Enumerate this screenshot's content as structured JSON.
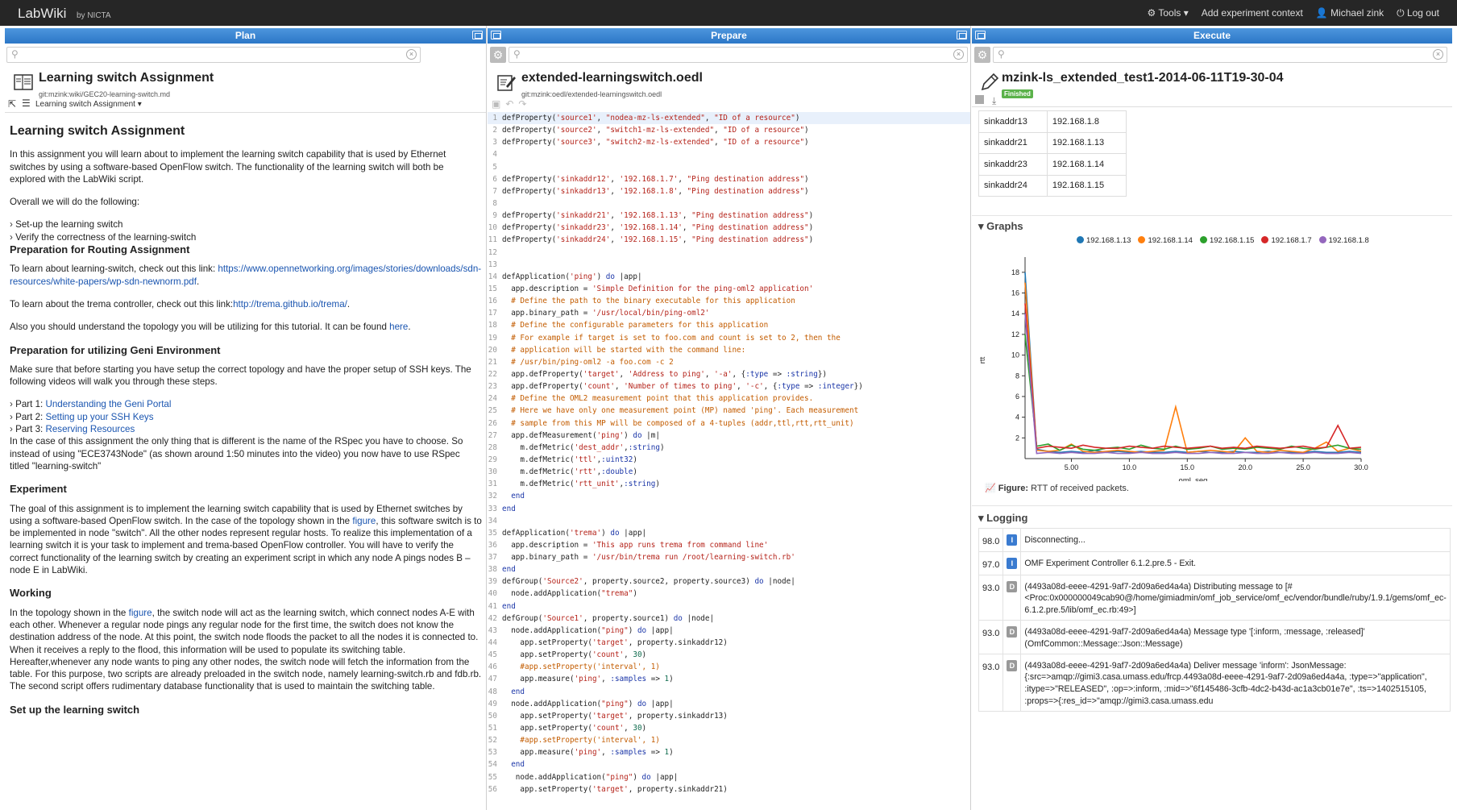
{
  "topbar": {
    "brand": "LabWiki",
    "byline": "by NICTA",
    "tools": "⚙ Tools ▾",
    "add_context": "Add experiment context",
    "user": "👤 Michael zink",
    "logout": "⏻ Log out"
  },
  "plan": {
    "header": "Plan",
    "doc_title": "Learning switch Assignment",
    "doc_path": "git:mzink:wiki/GEC20-learning-switch.md",
    "toolbar_label": "Learning switch Assignment",
    "h1": "Learning switch Assignment",
    "intro": "In this assignment you will learn about to implement the learning switch capability that is used by Ethernet switches by using a software-based OpenFlow switch. The functionality of the learning switch will both be explored with the LabWiki script.",
    "overall": "Overall we will do the following:",
    "bullets": [
      "Set-up the learning switch",
      "Verify the correctness of the learning-switch"
    ],
    "h_routing": "Preparation for Routing Assignment",
    "routing_text": "To learn about learning-switch, check out this link: ",
    "routing_link": "https://www.opennetworking.org/images/stories/downloads/sdn-resources/white-papers/wp-sdn-newnorm.pdf",
    "routing_end": ".",
    "trema_text": "To learn about the trema controller, check out this link:",
    "trema_link": "http://trema.github.io/trema/",
    "trema_end": ".",
    "topology_text": "Also you should understand the topology you will be utilizing for this tutorial. It can be found ",
    "topology_link": "here",
    "topology_end": ".",
    "h_geni": "Preparation for utilizing Geni Environment",
    "geni_text": "Make sure that before starting you have setup the correct topology and have the proper setup of SSH keys. The following videos will walk you through these steps.",
    "parts": [
      {
        "label": "Part 1: ",
        "link": "Understanding the Geni Portal"
      },
      {
        "label": "Part 2: ",
        "link": "Setting up your SSH Keys"
      },
      {
        "label": "Part 3: ",
        "link": "Reserving Resources"
      }
    ],
    "rspec_text": "In the case of this assignment the only thing that is different is the name of the RSpec you have to choose. So instead of using \"ECE3743Node\" (as shown around 1:50 minutes into the video) you now have to use RSpec titled \"learning-switch\"",
    "h_experiment": "Experiment",
    "exp_text1": "The goal of this assignment is to implement the learning switch capability that is used by Ethernet switches by using a software-based OpenFlow switch. In the case of the topology shown in the ",
    "exp_link": "figure",
    "exp_text2": ", this software switch is to be implemented in node \"switch\". All the other nodes represent regular hosts. To realize this implementation of a learning switch it is your task to implement and trema-based OpenFlow controller. You will have to verify the correct functionality of the learning switch by creating an experiment script in which any node A pings nodes B – node E in LabWiki.",
    "h_working": "Working",
    "work_text1": "In the topology shown in the ",
    "work_link": "figure",
    "work_text2": ", the switch node will act as the learning switch, which connect nodes A-E with each other. Whenever a regular node pings any regular node for the first time, the switch does not know the destination address of the node. At this point, the switch node floods the packet to all the nodes it is connected to. When it receives a reply to the flood, this information will be used to populate its switching table. Hereafter,whenever any node wants to ping any other nodes, the switch node will fetch the information from the table. For this purpose, two scripts are already preloaded in the switch node, namely learning-switch.rb and fdb.rb. The second script offers rudimentary database functionality that is used to maintain the switching table.",
    "h_setup": "Set up the learning switch"
  },
  "prepare": {
    "header": "Prepare",
    "doc_title": "extended-learningswitch.oedl",
    "doc_path": "git:mzink:oedl/extended-learningswitch.oedl",
    "code": [
      "defProperty('source1', \"nodea-mz-ls-extended\", \"ID of a resource\")",
      "defProperty('source2', \"switch1-mz-ls-extended\", \"ID of a resource\")",
      "defProperty('source3', \"switch2-mz-ls-extended\", \"ID of a resource\")",
      "",
      "",
      "defProperty('sinkaddr12', '192.168.1.7', \"Ping destination address\")",
      "defProperty('sinkaddr13', '192.168.1.8', \"Ping destination address\")",
      "",
      "defProperty('sinkaddr21', '192.168.1.13', \"Ping destination address\")",
      "defProperty('sinkaddr23', '192.168.1.14', \"Ping destination address\")",
      "defProperty('sinkaddr24', '192.168.1.15', \"Ping destination address\")",
      "",
      "",
      "defApplication('ping') do |app|",
      "  app.description = 'Simple Definition for the ping-oml2 application'",
      "  # Define the path to the binary executable for this application",
      "  app.binary_path = '/usr/local/bin/ping-oml2'",
      "  # Define the configurable parameters for this application",
      "  # For example if target is set to foo.com and count is set to 2, then the",
      "  # application will be started with the command line:",
      "  # /usr/bin/ping-oml2 -a foo.com -c 2",
      "  app.defProperty('target', 'Address to ping', '-a', {:type => :string})",
      "  app.defProperty('count', 'Number of times to ping', '-c', {:type => :integer})",
      "  # Define the OML2 measurement point that this application provides.",
      "  # Here we have only one measurement point (MP) named 'ping'. Each measurement",
      "  # sample from this MP will be composed of a 4-tuples (addr,ttl,rtt,rtt_unit)",
      "  app.defMeasurement('ping') do |m|",
      "    m.defMetric('dest_addr',:string)",
      "    m.defMetric('ttl',:uint32)",
      "    m.defMetric('rtt',:double)",
      "    m.defMetric('rtt_unit',:string)",
      "  end",
      "end",
      "",
      "defApplication('trema') do |app|",
      "  app.description = 'This app runs trema from command line'",
      "  app.binary_path = '/usr/bin/trema run /root/learning-switch.rb'",
      "end",
      "defGroup('Source2', property.source2, property.source3) do |node|",
      "  node.addApplication(\"trema\")",
      "end",
      "defGroup('Source1', property.source1) do |node|",
      "  node.addApplication(\"ping\") do |app|",
      "    app.setProperty('target', property.sinkaddr12)",
      "    app.setProperty('count', 30)",
      "    #app.setProperty('interval', 1)",
      "    app.measure('ping', :samples => 1)",
      "  end",
      "  node.addApplication(\"ping\") do |app|",
      "    app.setProperty('target', property.sinkaddr13)",
      "    app.setProperty('count', 30)",
      "    #app.setProperty('interval', 1)",
      "    app.measure('ping', :samples => 1)",
      "  end",
      "   node.addApplication(\"ping\") do |app|",
      "    app.setProperty('target', property.sinkaddr21)"
    ]
  },
  "execute": {
    "header": "Execute",
    "doc_title": "mzink-ls_extended_test1-2014-06-11T19-30-04",
    "status": "Finished",
    "props": [
      {
        "name": "sinkaddr13",
        "value": "192.168.1.8"
      },
      {
        "name": "sinkaddr21",
        "value": "192.168.1.13"
      },
      {
        "name": "sinkaddr23",
        "value": "192.168.1.14"
      },
      {
        "name": "sinkaddr24",
        "value": "192.168.1.15"
      }
    ],
    "graphs_title": "▾ Graphs",
    "figure_label": "Figure:",
    "figure_caption": " RTT of received packets.",
    "logging_title": "▾ Logging",
    "logs": [
      {
        "time": "98.0",
        "level": "i",
        "icon": "I",
        "msg": "Disconnecting..."
      },
      {
        "time": "97.0",
        "level": "i",
        "icon": "I",
        "msg": "OMF Experiment Controller 6.1.2.pre.5 - Exit."
      },
      {
        "time": "93.0",
        "level": "d",
        "icon": "D",
        "msg": "(4493a08d-eeee-4291-9af7-2d09a6ed4a4a) Distributing message to [#<Proc:0x000000049cab90@/home/gimiadmin/omf_job_service/omf_ec/vendor/bundle/ruby/1.9.1/gems/omf_ec-6.1.2.pre.5/lib/omf_ec.rb:49>]"
      },
      {
        "time": "93.0",
        "level": "d",
        "icon": "D",
        "msg": "(4493a08d-eeee-4291-9af7-2d09a6ed4a4a) Message type '[:inform, :message, :released]' (OmfCommon::Message::Json::Message)"
      },
      {
        "time": "93.0",
        "level": "d",
        "icon": "D",
        "msg": "(4493a08d-eeee-4291-9af7-2d09a6ed4a4a) Deliver message 'inform': JsonMessage: {:src=>amqp://gimi3.casa.umass.edu/frcp.4493a08d-eeee-4291-9af7-2d09a6ed4a4a, :type=>\"application\", :itype=>\"RELEASED\", :op=>:inform, :mid=>\"6f145486-3cfb-4dc2-b43d-ac1a3cb01e7e\", :ts=>1402515105, :props=>{:res_id=>\"amqp://gimi3.casa.umass.edu"
      }
    ]
  },
  "chart_data": {
    "type": "line",
    "xlabel": "oml_seq",
    "ylabel": "rtt",
    "xlim": [
      1,
      30
    ],
    "ylim": [
      0,
      19
    ],
    "x_ticks": [
      "5.00",
      "10.0",
      "15.0",
      "20.0",
      "25.0",
      "30.0"
    ],
    "y_ticks": [
      "2",
      "4",
      "6",
      "8",
      "10",
      "12",
      "14",
      "16",
      "18"
    ],
    "legend_position": "top",
    "x": [
      1,
      2,
      3,
      4,
      5,
      6,
      7,
      8,
      9,
      10,
      11,
      12,
      13,
      14,
      15,
      16,
      17,
      18,
      19,
      20,
      21,
      22,
      23,
      24,
      25,
      26,
      27,
      28,
      29,
      30
    ],
    "series": [
      {
        "name": "192.168.1.13",
        "color": "#1f77b4",
        "values": [
          18,
          0.9,
          0.7,
          0.6,
          0.7,
          0.6,
          0.8,
          0.6,
          0.7,
          0.6,
          0.7,
          0.6,
          0.6,
          0.7,
          0.6,
          0.7,
          0.6,
          0.6,
          0.7,
          0.6,
          0.6,
          0.7,
          0.6,
          0.6,
          0.6,
          0.7,
          0.6,
          0.6,
          0.7,
          0.6
        ]
      },
      {
        "name": "192.168.1.14",
        "color": "#ff7f0e",
        "values": [
          17,
          0.8,
          0.7,
          0.8,
          1.4,
          0.7,
          0.6,
          0.7,
          0.8,
          0.7,
          0.6,
          0.7,
          0.8,
          5.0,
          0.6,
          0.7,
          0.8,
          0.7,
          0.6,
          2.0,
          0.7,
          0.6,
          0.8,
          0.7,
          0.6,
          1.0,
          1.6,
          0.7,
          1.0,
          0.7
        ]
      },
      {
        "name": "192.168.1.15",
        "color": "#2ca02c",
        "values": [
          12,
          1.2,
          1.4,
          0.8,
          1.3,
          0.9,
          0.8,
          1.0,
          1.1,
          0.9,
          1.3,
          1.0,
          0.9,
          1.2,
          0.9,
          1.0,
          1.2,
          0.9,
          1.0,
          0.9,
          1.1,
          1.0,
          0.9,
          1.2,
          1.0,
          0.9,
          1.1,
          1.3,
          1.0,
          0.9
        ]
      },
      {
        "name": "192.168.1.7",
        "color": "#d62728",
        "values": [
          15,
          1.0,
          1.2,
          1.1,
          1.0,
          1.3,
          1.1,
          1.0,
          1.0,
          1.2,
          1.1,
          1.0,
          1.2,
          1.1,
          1.0,
          1.1,
          1.2,
          1.0,
          1.1,
          1.0,
          1.2,
          1.1,
          1.0,
          1.1,
          1.2,
          1.0,
          1.1,
          3.2,
          1.0,
          1.1
        ]
      },
      {
        "name": "192.168.1.8",
        "color": "#9467bd",
        "values": [
          14,
          0.5,
          0.6,
          0.5,
          0.6,
          0.5,
          0.5,
          0.6,
          0.5,
          0.5,
          0.6,
          0.5,
          0.5,
          0.6,
          0.5,
          0.5,
          0.6,
          0.5,
          0.5,
          0.6,
          0.5,
          0.5,
          0.6,
          0.5,
          0.5,
          0.6,
          0.5,
          0.5,
          0.6,
          0.5
        ]
      }
    ]
  }
}
